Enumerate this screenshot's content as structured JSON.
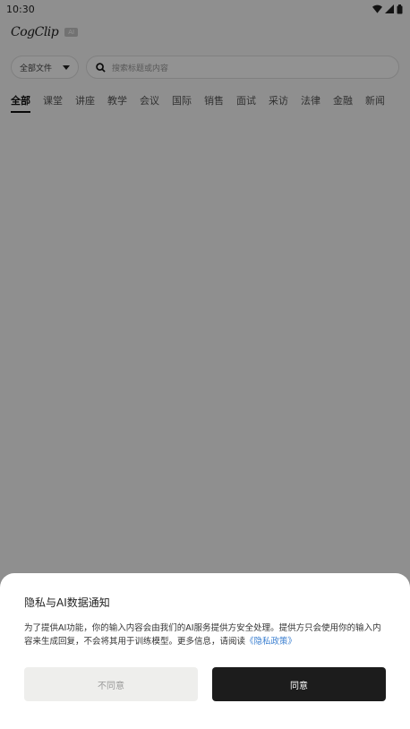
{
  "status": {
    "time": "10:30",
    "icons": [
      "wifi-icon",
      "cell-signal-icon",
      "battery-icon"
    ]
  },
  "app": {
    "logo": "CogClip",
    "badge": "AI"
  },
  "filter": {
    "dropdown_label": "全部文件",
    "search_placeholder": "搜索标题或内容"
  },
  "tabs": [
    {
      "label": "全部",
      "active": true
    },
    {
      "label": "课堂"
    },
    {
      "label": "讲座"
    },
    {
      "label": "教学"
    },
    {
      "label": "会议"
    },
    {
      "label": "国际"
    },
    {
      "label": "销售"
    },
    {
      "label": "面试"
    },
    {
      "label": "采访"
    },
    {
      "label": "法律"
    },
    {
      "label": "金融"
    },
    {
      "label": "新闻"
    }
  ],
  "dialog": {
    "title": "隐私与AI数据通知",
    "body": "为了提供AI功能，你的输入内容会由我们的AI服务提供方安全处理。提供方只会使用你的输入内容来生成回复，不会将其用于训练模型。更多信息，请阅读",
    "link": "《隐私政策》",
    "disagree": "不同意",
    "agree": "同意"
  }
}
